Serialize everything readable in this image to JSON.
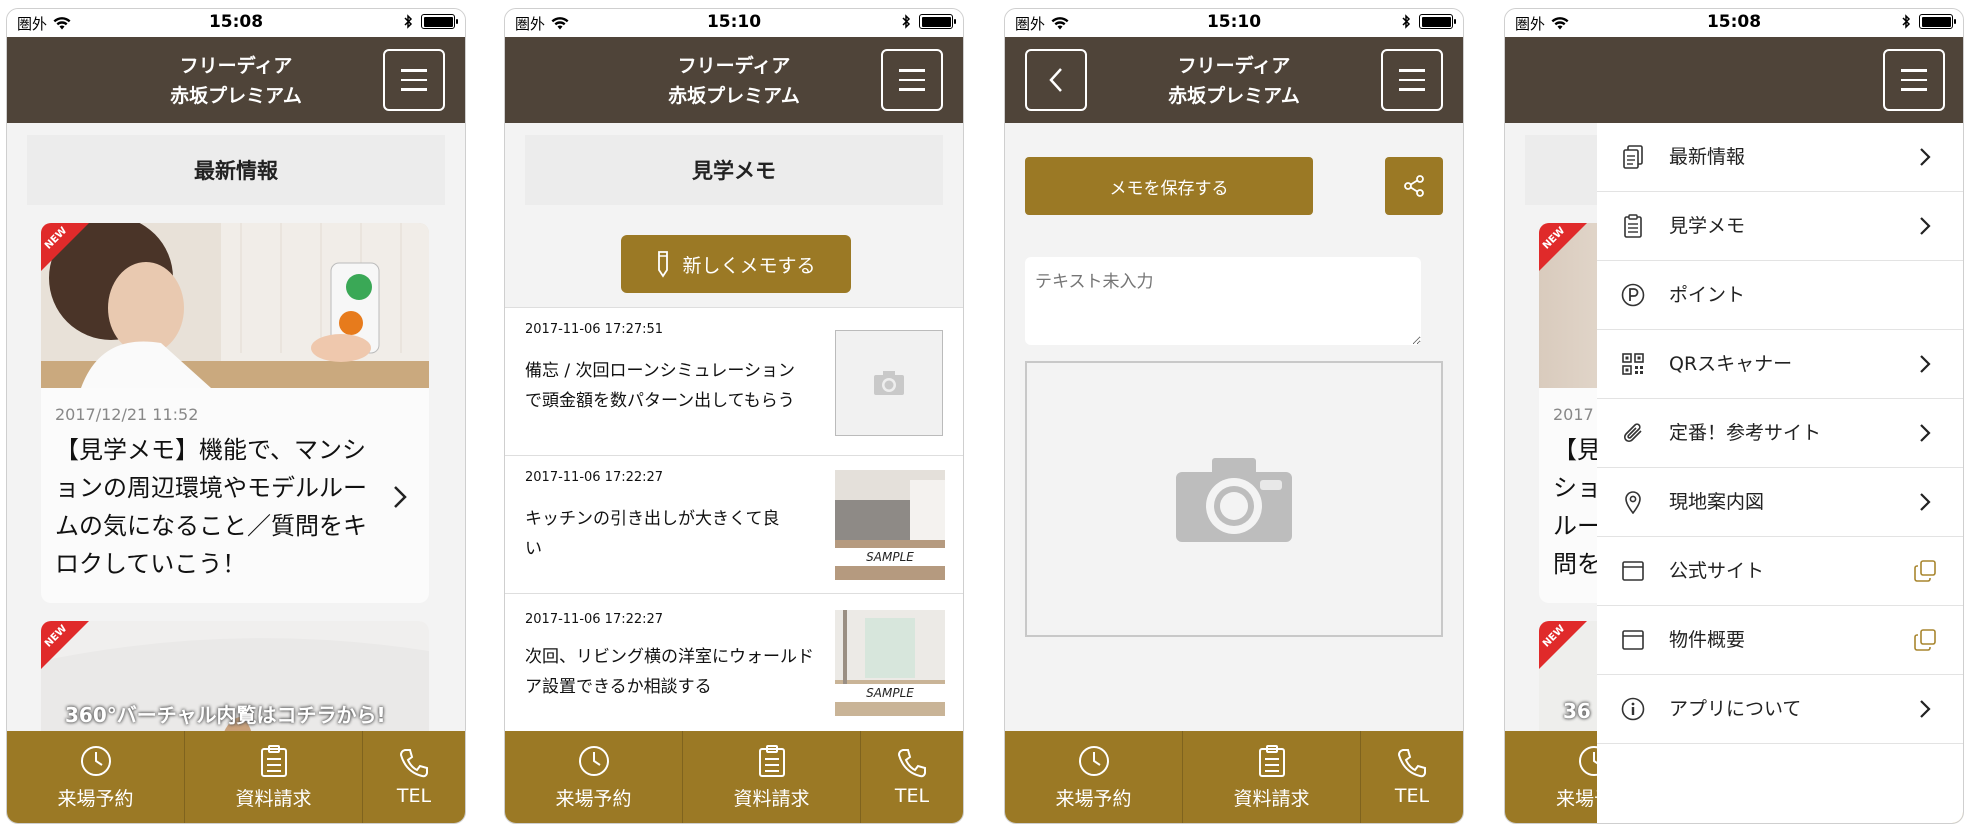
{
  "status_bar": {
    "carrier": "圏外",
    "time_1": "15:08",
    "time_2": "15:10",
    "time_3": "15:10",
    "time_4": "15:08"
  },
  "header": {
    "title_line1": "フリーディア",
    "title_line2": "赤坂プレミアム"
  },
  "tabbar": {
    "reservation": "来場予約",
    "documents": "資料請求",
    "tel": "TEL"
  },
  "screen1": {
    "section_title": "最新情報",
    "ribbon": "NEW",
    "card1_date": "2017/12/21 11:52",
    "card1_text": "【見学メモ】機能で、マンションの周辺環境やモデルルームの気になること／質問をキロクしていこう！",
    "card2_banner": "360°バーチャル内覧はコチラから!"
  },
  "screen2": {
    "section_title": "見学メモ",
    "new_memo_label": "新しくメモする",
    "memos": [
      {
        "date": "2017-11-06 17:27:51",
        "text": "備忘 / 次回ローンシミュレーションで頭金額を数パターン出してもらう"
      },
      {
        "date": "2017-11-06 17:22:27",
        "text": "キッチンの引き出しが大きくて良い",
        "badge": "SAMPLE"
      },
      {
        "date": "2017-11-06 17:22:27",
        "text": "次回、リビング横の洋室にウォールドア設置できるか相談する",
        "badge": "SAMPLE"
      }
    ]
  },
  "screen3": {
    "save_label": "メモを保存する",
    "input_placeholder": "テキスト未入力"
  },
  "screen4": {
    "partial_date": "2017",
    "partial_chars": [
      "【見",
      "ショ",
      "ルー",
      "問を"
    ],
    "partial_banner": "36",
    "menu": [
      {
        "label": "最新情報",
        "icon": "document-icon",
        "right": "chevron"
      },
      {
        "label": "見学メモ",
        "icon": "clipboard-icon",
        "right": "chevron"
      },
      {
        "label": "ポイント",
        "icon": "point-icon",
        "right": "none"
      },
      {
        "label": "QRスキャナー",
        "icon": "qr-icon",
        "right": "chevron"
      },
      {
        "label": "定番！参考サイト",
        "icon": "paperclip-icon",
        "right": "chevron"
      },
      {
        "label": "現地案内図",
        "icon": "map-pin-icon",
        "right": "chevron"
      },
      {
        "label": "公式サイト",
        "icon": "browser-icon",
        "right": "external"
      },
      {
        "label": "物件概要",
        "icon": "browser-icon",
        "right": "external"
      },
      {
        "label": "アプリについて",
        "icon": "info-icon",
        "right": "chevron"
      }
    ]
  },
  "colors": {
    "header": "#4f4439",
    "accent": "#9b7925",
    "ribbon": "#e02a2a"
  }
}
